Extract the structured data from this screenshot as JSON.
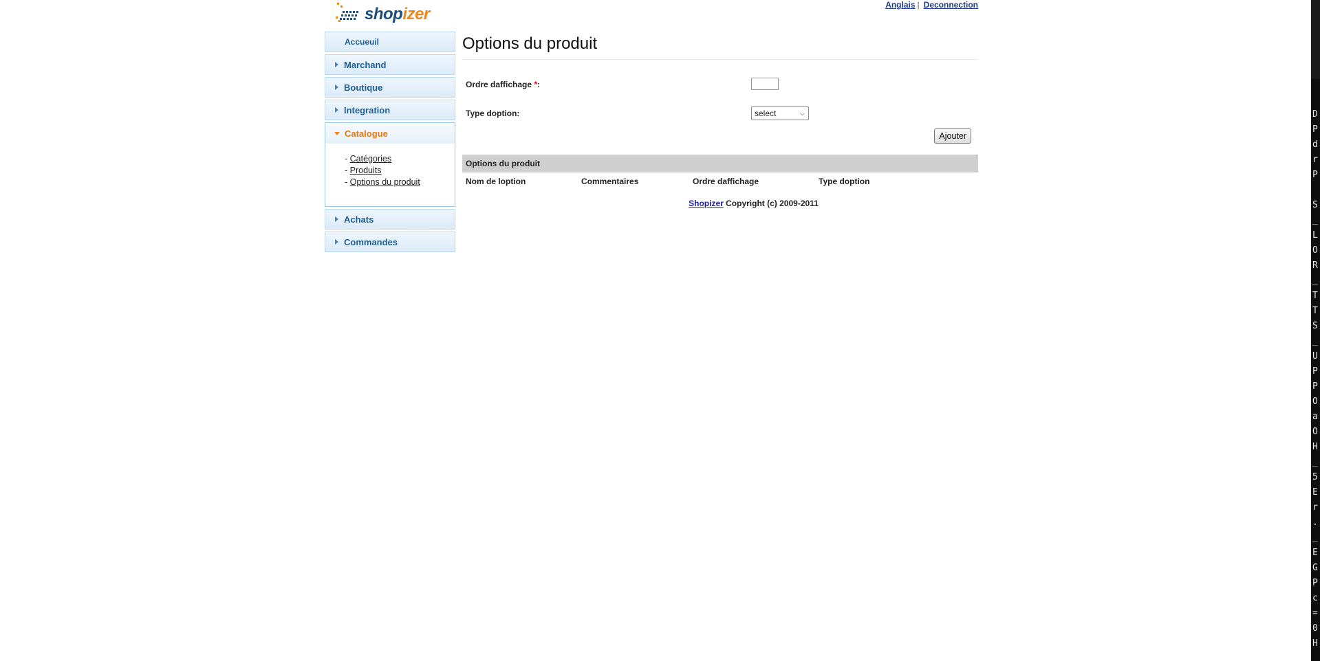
{
  "header": {
    "logo_shop": "shop",
    "logo_izer": "izer",
    "lang_link": "Anglais",
    "separator": "|",
    "logout_link": "Deconnection"
  },
  "sidebar": {
    "home": "Accueuil",
    "items": [
      {
        "label": "Marchand"
      },
      {
        "label": "Boutique"
      },
      {
        "label": "Integration"
      }
    ],
    "active": {
      "label": "Catalogue",
      "subitems": [
        "Catégories",
        "Produits",
        "Options du produit"
      ]
    },
    "items_after": [
      {
        "label": "Achats"
      },
      {
        "label": "Commandes"
      }
    ]
  },
  "main": {
    "title": "Options du produit",
    "form": {
      "order_label": "Ordre daffichage ",
      "order_required": "*",
      "order_colon": ":",
      "order_value": "",
      "type_label": "Type doption:",
      "type_selected": "select",
      "submit_label": "Ajouter"
    },
    "table": {
      "caption": "Options du produit",
      "columns": [
        "Nom de loption",
        "Commentaires",
        "Ordre daffichage",
        "Type doption"
      ]
    },
    "footer": {
      "link": "Shopizer",
      "text": " Copyright (c) 2009-2011"
    }
  },
  "terminal_edge": {
    "chars": "D\nP\nd\nr\nP\n \nS\n_\nL\nO\nR\n_\nT\nT\nS\n_\nU\nP\nP\nO\na\nO\nH\n_\n5\nE\nr\n.\n_\nE\nG\nP\nc\n=\n0\nH"
  }
}
